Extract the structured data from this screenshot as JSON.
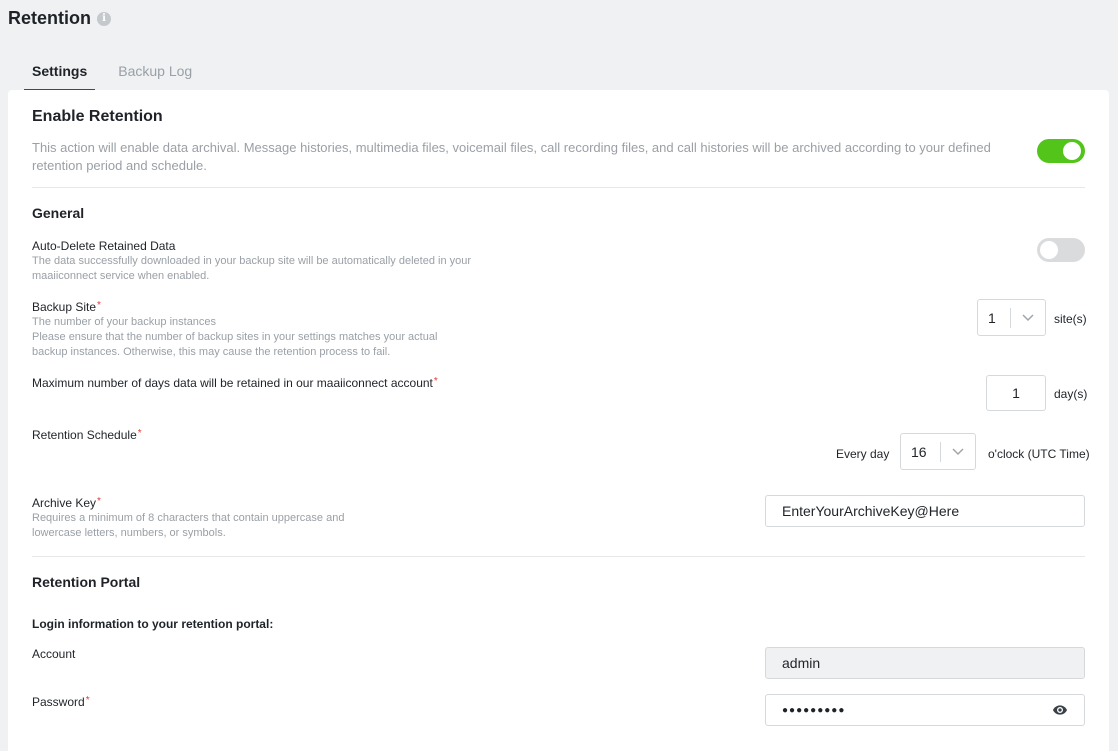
{
  "page": {
    "title": "Retention",
    "info_icon": "info-icon"
  },
  "tabs": [
    {
      "label": "Settings",
      "active": true
    },
    {
      "label": "Backup Log",
      "active": false
    }
  ],
  "enable_retention": {
    "title": "Enable Retention",
    "description": "This action will enable data archival. Message histories, multimedia files, voicemail files, call recording files, and call histories will be archived according to your defined retention period and schedule.",
    "enabled": true
  },
  "general": {
    "title": "General",
    "auto_delete": {
      "label": "Auto-Delete Retained Data",
      "description": "The data successfully downloaded in your backup site will be automatically deleted in your maaiiconnect service when enabled.",
      "enabled": false
    },
    "backup_site": {
      "label": "Backup Site",
      "required": "*",
      "desc1": "The number of your backup instances",
      "desc2": "Please ensure that the number of backup sites in your settings matches your actual backup instances. Otherwise, this may cause the retention process to fail.",
      "value": "1",
      "unit": "site(s)"
    },
    "max_days": {
      "label": "Maximum number of days data will be retained in our maaiiconnect account",
      "required": "*",
      "value": "1",
      "unit": "day(s)"
    },
    "schedule": {
      "label": "Retention Schedule",
      "required": "*",
      "prefix": "Every day",
      "value": "16",
      "unit": "o'clock (UTC Time)"
    },
    "archive_key": {
      "label": "Archive Key",
      "required": "*",
      "description": "Requires a minimum of 8 characters that contain uppercase and lowercase letters, numbers, or symbols.",
      "value": "EnterYourArchiveKey@Here"
    }
  },
  "portal": {
    "title": "Retention Portal",
    "login_info": "Login information to your retention portal:",
    "account": {
      "label": "Account",
      "value": "admin"
    },
    "password": {
      "label": "Password",
      "required": "*",
      "value": "●●●●●●●●●",
      "icon": "eye-icon"
    }
  },
  "colors": {
    "toggle_on": "#52c41a",
    "toggle_off": "#d9dbdd",
    "required": "#e53935",
    "muted_text": "#9aa0a6"
  }
}
